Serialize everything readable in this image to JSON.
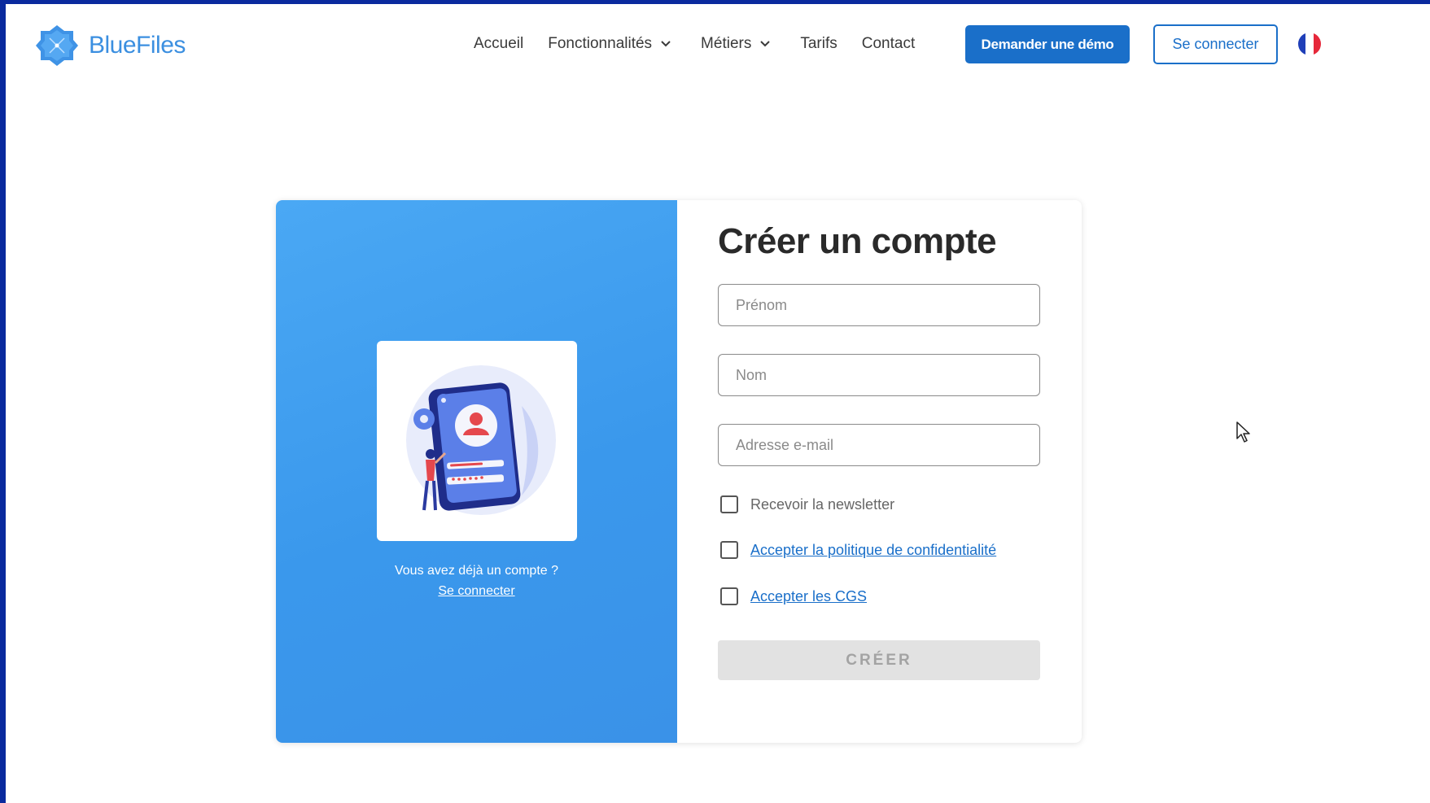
{
  "brand": {
    "name": "BlueFiles",
    "logo_icon": "bluefiles-logo-icon",
    "accent": "#1a6fc9"
  },
  "nav": {
    "items": [
      {
        "label": "Accueil",
        "has_dropdown": false
      },
      {
        "label": "Fonctionnalités",
        "has_dropdown": true
      },
      {
        "label": "Métiers",
        "has_dropdown": true
      },
      {
        "label": "Tarifs",
        "has_dropdown": false
      },
      {
        "label": "Contact",
        "has_dropdown": false
      }
    ],
    "demo_button": "Demander une démo",
    "login_button": "Se connecter",
    "language_icon": "france-flag-icon"
  },
  "side_panel": {
    "illustration": "account-signup-illustration",
    "already_text": "Vous avez déjà un compte ?",
    "login_link": "Se connecter",
    "colors": {
      "gradient_start": "#4aa8f4",
      "gradient_end": "#3a92e8"
    }
  },
  "form": {
    "title": "Créer un compte",
    "first_name": {
      "placeholder": "Prénom",
      "value": ""
    },
    "last_name": {
      "placeholder": "Nom",
      "value": ""
    },
    "email": {
      "placeholder": "Adresse e-mail",
      "value": ""
    },
    "checkboxes": {
      "newsletter": {
        "label": "Recevoir la newsletter",
        "checked": false
      },
      "privacy": {
        "label": "Accepter la politique de confidentialité",
        "checked": false
      },
      "terms": {
        "label": "Accepter les CGS",
        "checked": false
      }
    },
    "submit_label": "CRÉER",
    "submit_disabled": true
  }
}
